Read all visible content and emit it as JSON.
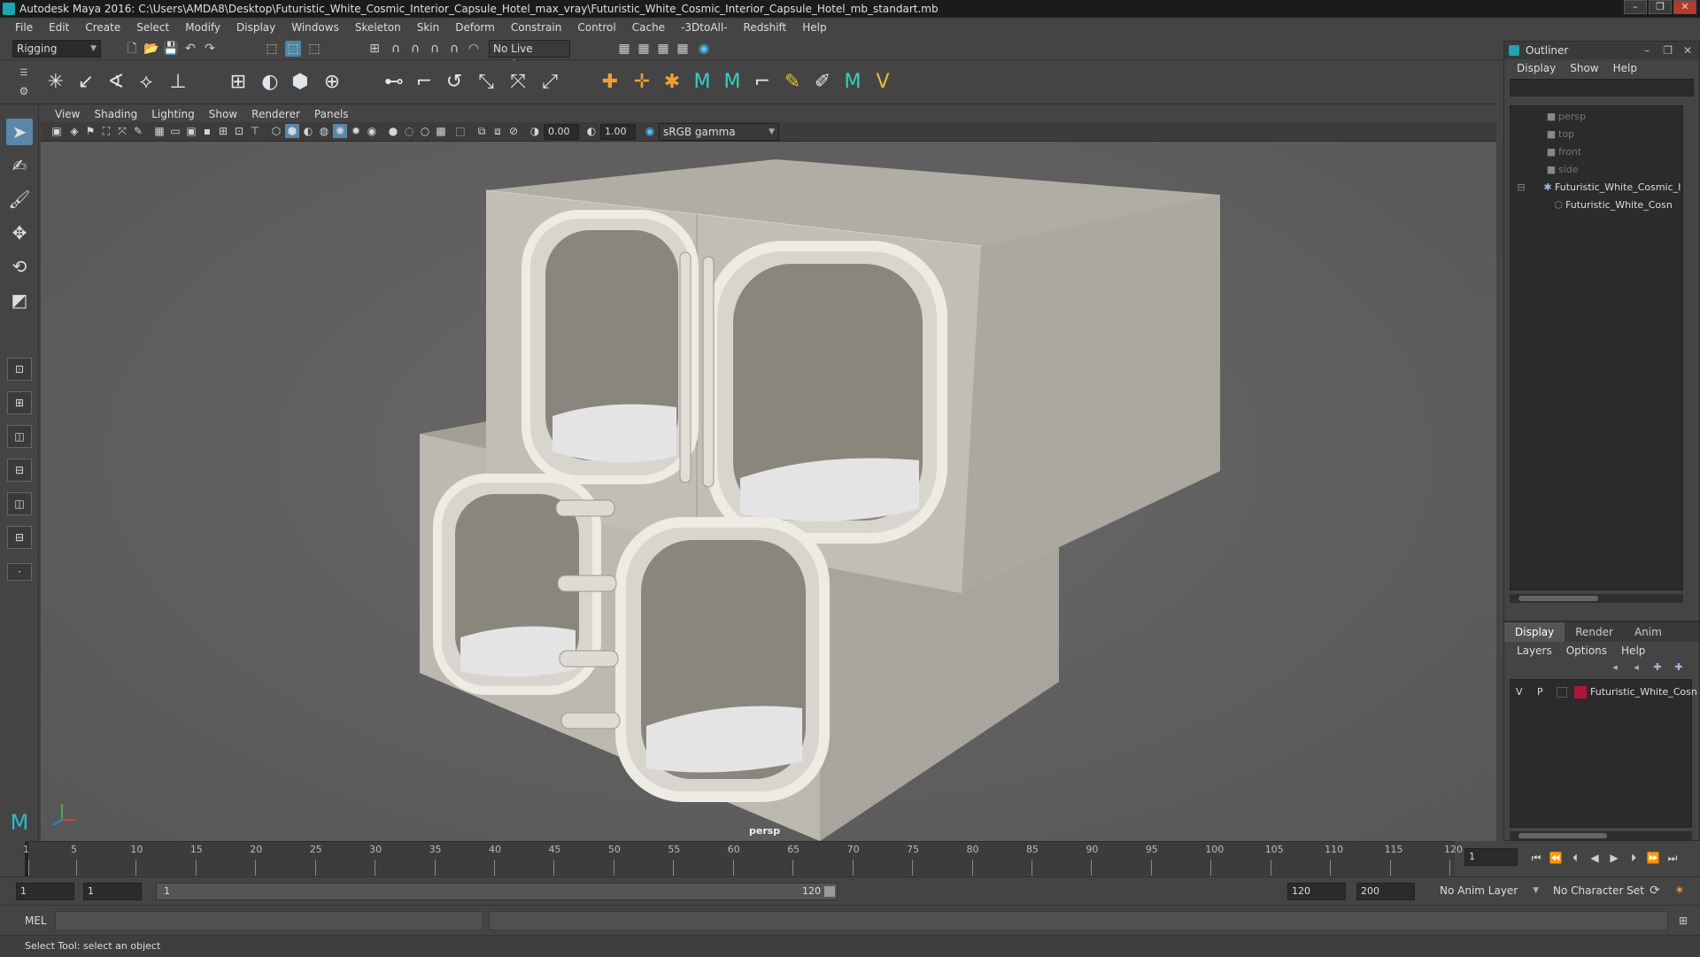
{
  "titlebar": {
    "title": "Autodesk Maya 2016: C:\\Users\\AMDA8\\Desktop\\Futuristic_White_Cosmic_Interior_Capsule_Hotel_max_vray\\Futuristic_White_Cosmic_Interior_Capsule_Hotel_mb_standart.mb"
  },
  "menubar": [
    "File",
    "Edit",
    "Create",
    "Select",
    "Modify",
    "Display",
    "Windows",
    "Skeleton",
    "Skin",
    "Deform",
    "Constrain",
    "Control",
    "Cache",
    "-3DtoAll-",
    "Redshift",
    "Help"
  ],
  "toolbar": {
    "menuset": "Rigging",
    "live_surface": "No Live Surface"
  },
  "panel": {
    "menu": [
      "View",
      "Shading",
      "Lighting",
      "Show",
      "Renderer",
      "Panels"
    ],
    "exposure": "0.00",
    "gamma": "1.00",
    "color_space": "sRGB gamma",
    "camera_label": "persp"
  },
  "outliner": {
    "title": "Outliner",
    "menu": [
      "Display",
      "Show",
      "Help"
    ],
    "items": [
      {
        "label": "persp",
        "dim": true
      },
      {
        "label": "top",
        "dim": true
      },
      {
        "label": "front",
        "dim": true
      },
      {
        "label": "side",
        "dim": true
      },
      {
        "label": "Futuristic_White_Cosmic_I",
        "dim": false
      },
      {
        "label": "Futuristic_White_Cosn",
        "dim": false
      }
    ]
  },
  "channel": {
    "tabs": [
      "Display",
      "Render",
      "Anim"
    ],
    "menu": [
      "Layers",
      "Options",
      "Help"
    ],
    "layer": {
      "v": "V",
      "p": "P",
      "name": "Futuristic_White_Cosn",
      "color": "#b0163a"
    }
  },
  "timeline": {
    "ticks": [
      1,
      5,
      10,
      15,
      20,
      25,
      30,
      35,
      40,
      45,
      50,
      55,
      60,
      65,
      70,
      75,
      80,
      85,
      90,
      95,
      100,
      105,
      110,
      115,
      120
    ],
    "current_frame": "1"
  },
  "range": {
    "start": "1",
    "playback_start": "1",
    "slider_start": "1",
    "slider_end": "120",
    "playback_end": "120",
    "end": "200",
    "anim_layer": "No Anim Layer",
    "character_set": "No Character Set"
  },
  "cmdline": {
    "label": "MEL"
  },
  "helpline": {
    "text": "Select Tool: select an object"
  }
}
